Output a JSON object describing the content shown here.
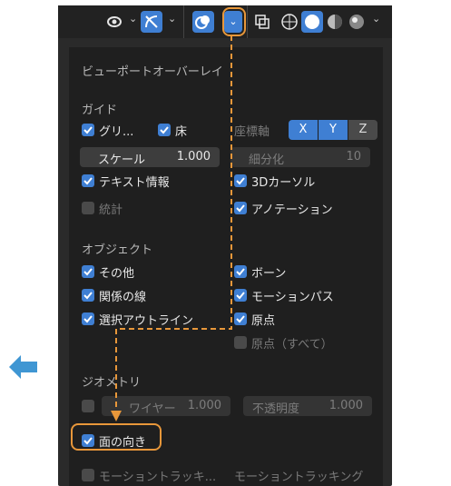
{
  "toolbar": {
    "icons": [
      "visibility-icon",
      "gizmo-icon",
      "overlay-icon",
      "overlay-dropdown",
      "xray-icon",
      "wireframe-shading",
      "solid-shading",
      "material-shading",
      "rendered-shading",
      "shading-dropdown"
    ]
  },
  "popup": {
    "title": "ビューポートオーバーレイ",
    "guide": {
      "heading": "ガイド",
      "grid_label": "グリ...",
      "floor_label": "床",
      "axis_label": "座標軸",
      "axis_x": "X",
      "axis_y": "Y",
      "axis_z": "Z",
      "scale_label": "スケール",
      "scale_value": "1.000",
      "subdiv_label": "細分化",
      "subdiv_value": "10",
      "text_info_label": "テキスト情報",
      "cursor_label": "3Dカーソル",
      "stats_label": "統計",
      "annotation_label": "アノテーション"
    },
    "objects": {
      "heading": "オブジェクト",
      "extras_label": "その他",
      "bones_label": "ボーン",
      "relations_label": "関係の線",
      "motion_paths_label": "モーションパス",
      "outline_label": "選択アウトライン",
      "origins_label": "原点",
      "origins_all_label": "原点（すべて）"
    },
    "geometry": {
      "heading": "ジオメトリ",
      "wireframe_label": "ワイヤー",
      "wireframe_value": "1.000",
      "opacity_label": "不透明度",
      "opacity_value": "1.000",
      "face_orientation_label": "面の向き",
      "motion_tracking_short": "モーショントラッキ...",
      "motion_tracking_label": "モーショントラッキング"
    }
  },
  "colors": {
    "accent": "#3f7fd3",
    "highlight": "#e8973a",
    "panel_bg": "#1f1f1f"
  }
}
